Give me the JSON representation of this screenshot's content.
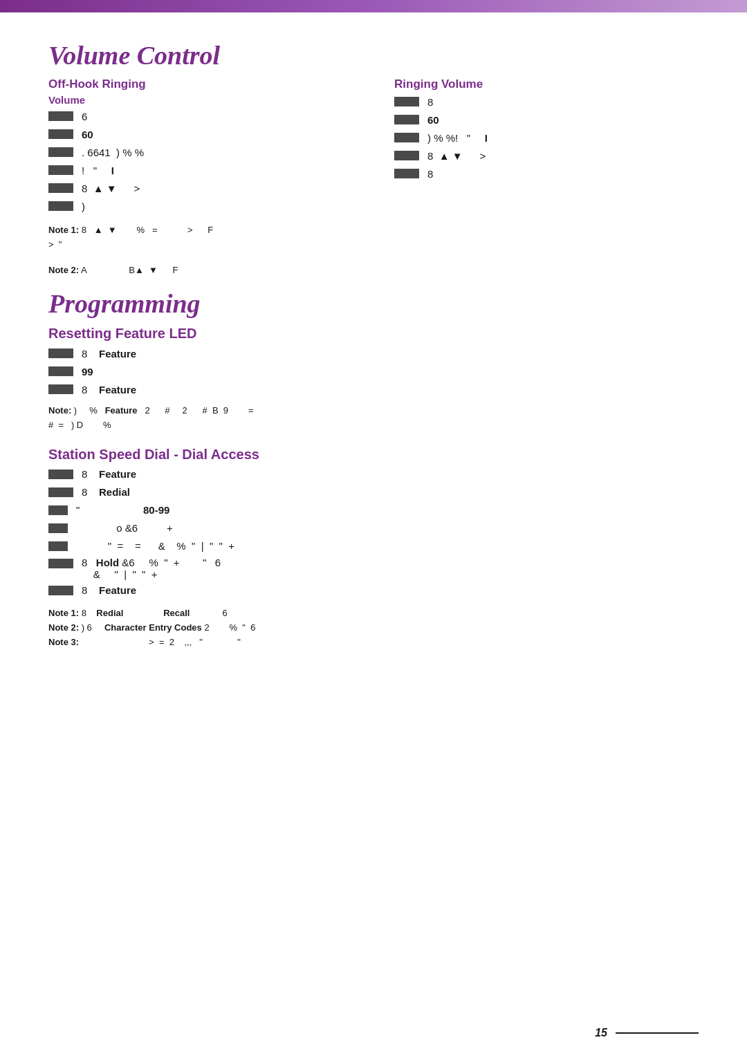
{
  "top_bar": {},
  "page": {
    "number": "15"
  },
  "volume_control": {
    "title": "Volume Control",
    "off_hook": {
      "heading": "Off-Hook Ringing",
      "sub_heading": "Volume",
      "steps": [
        {
          "bar": true,
          "text": "6"
        },
        {
          "bar": true,
          "text": "60"
        },
        {
          "bar": true,
          "text": ". 6641  )  % %"
        },
        {
          "bar": true,
          "text": "!  \"     I"
        },
        {
          "bar": true,
          "text": "8   ▲  ▼      >"
        },
        {
          "bar": true,
          "text": ")"
        }
      ]
    },
    "ringing": {
      "heading": "Ringing Volume",
      "steps": [
        {
          "bar": true,
          "text": "8"
        },
        {
          "bar": true,
          "text": "60"
        },
        {
          "bar": true,
          "text": ")  % %!   \"     I"
        },
        {
          "bar": true,
          "text": "8   ▲  ▼      >"
        },
        {
          "bar": true,
          "text": "8"
        }
      ]
    },
    "note1": "Note 1: 8   ▲  ▼      %   =            >      F\n>   \"",
    "note2": "Note 2: A                  B▲  ▼            F"
  },
  "programming": {
    "title": "Programming",
    "resetting_led": {
      "heading": "Resetting Feature LED",
      "steps": [
        {
          "bar": true,
          "text": "8",
          "bold_text": "Feature"
        },
        {
          "bar": true,
          "text": "99"
        },
        {
          "bar": true,
          "text": "8",
          "bold_text": "Feature"
        }
      ],
      "note": "Note: )      %   Feature   2      #    2      #  B  9       =\n#  =   ) D       %"
    },
    "station_speed": {
      "heading": "Station Speed Dial - Dial Access",
      "steps": [
        {
          "bar": true,
          "text": "8",
          "bold_text": "Feature"
        },
        {
          "bar": true,
          "text": "8",
          "bold_text": "Redial"
        },
        {
          "bar": true,
          "text": "\"                  80-99"
        },
        {
          "bar": true,
          "text": "o &6           +"
        },
        {
          "bar": true,
          "text": "\"  =    =      &    %  \"  |  \"  \"  +"
        },
        {
          "bar": true,
          "text": "8",
          "bold_text": "Hold",
          "extra": "&6    %  \"  +        \"    6\n&     \"  |  \"  \"  +"
        },
        {
          "bar": true,
          "text": "8",
          "bold_text": "Feature"
        }
      ],
      "note1": "Note 1: 8    Redial                 Recall               6",
      "note2": "Note 2: ) 6     Character Entry Codes 2        %  \"  6",
      "note3": "Note 3:                            >  =  2    ,,,   \"              \""
    }
  }
}
